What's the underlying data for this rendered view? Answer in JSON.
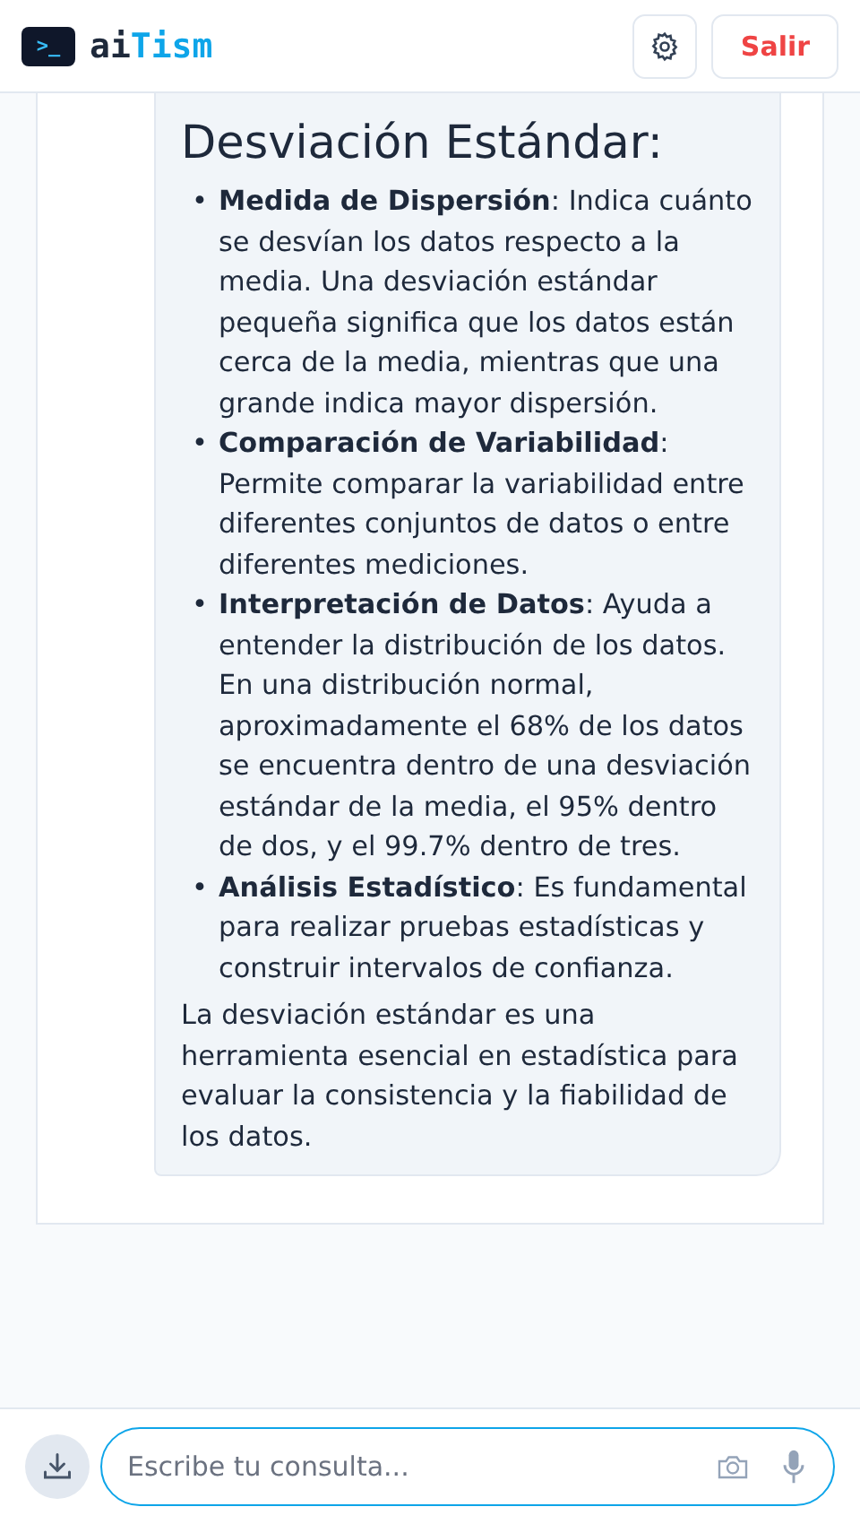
{
  "header": {
    "logo_glyph": ">_",
    "brand_prefix": "ai",
    "brand_suffix": "Tism",
    "logout": "Salir"
  },
  "message": {
    "heading": "Desviación Estándar:",
    "items": [
      {
        "marker": "•",
        "text": "**Medida de Dispersión**: Indica cuánto se desvían los datos respecto a la media. Una desviación estándar pequeña significa que los datos están cerca de la media, mientras que una grande indica mayor dispersión."
      },
      {
        "marker": "•",
        "text": "**Comparación de Variabilidad**: Permite comparar la variabilidad entre diferentes conjuntos de datos o entre diferentes mediciones."
      },
      {
        "marker": "•",
        "text": "**Interpretación de Datos**: Ayuda a entender la distribución de los datos. En una distribución normal, aproximadamente el 68% de los datos se encuentra dentro de una desviación estándar de la media, el 95% dentro de dos, y el 99.7% dentro de tres."
      },
      {
        "marker": "•",
        "text": "**Análisis Estadístico**: Es fundamental para realizar pruebas estadísticas y construir intervalos de confianza."
      }
    ],
    "closing": "La desviación estándar es una herramienta esencial en estadística para evaluar la consistencia y la fiabilidad de los datos."
  },
  "composer": {
    "placeholder": "Escribe tu consulta..."
  }
}
